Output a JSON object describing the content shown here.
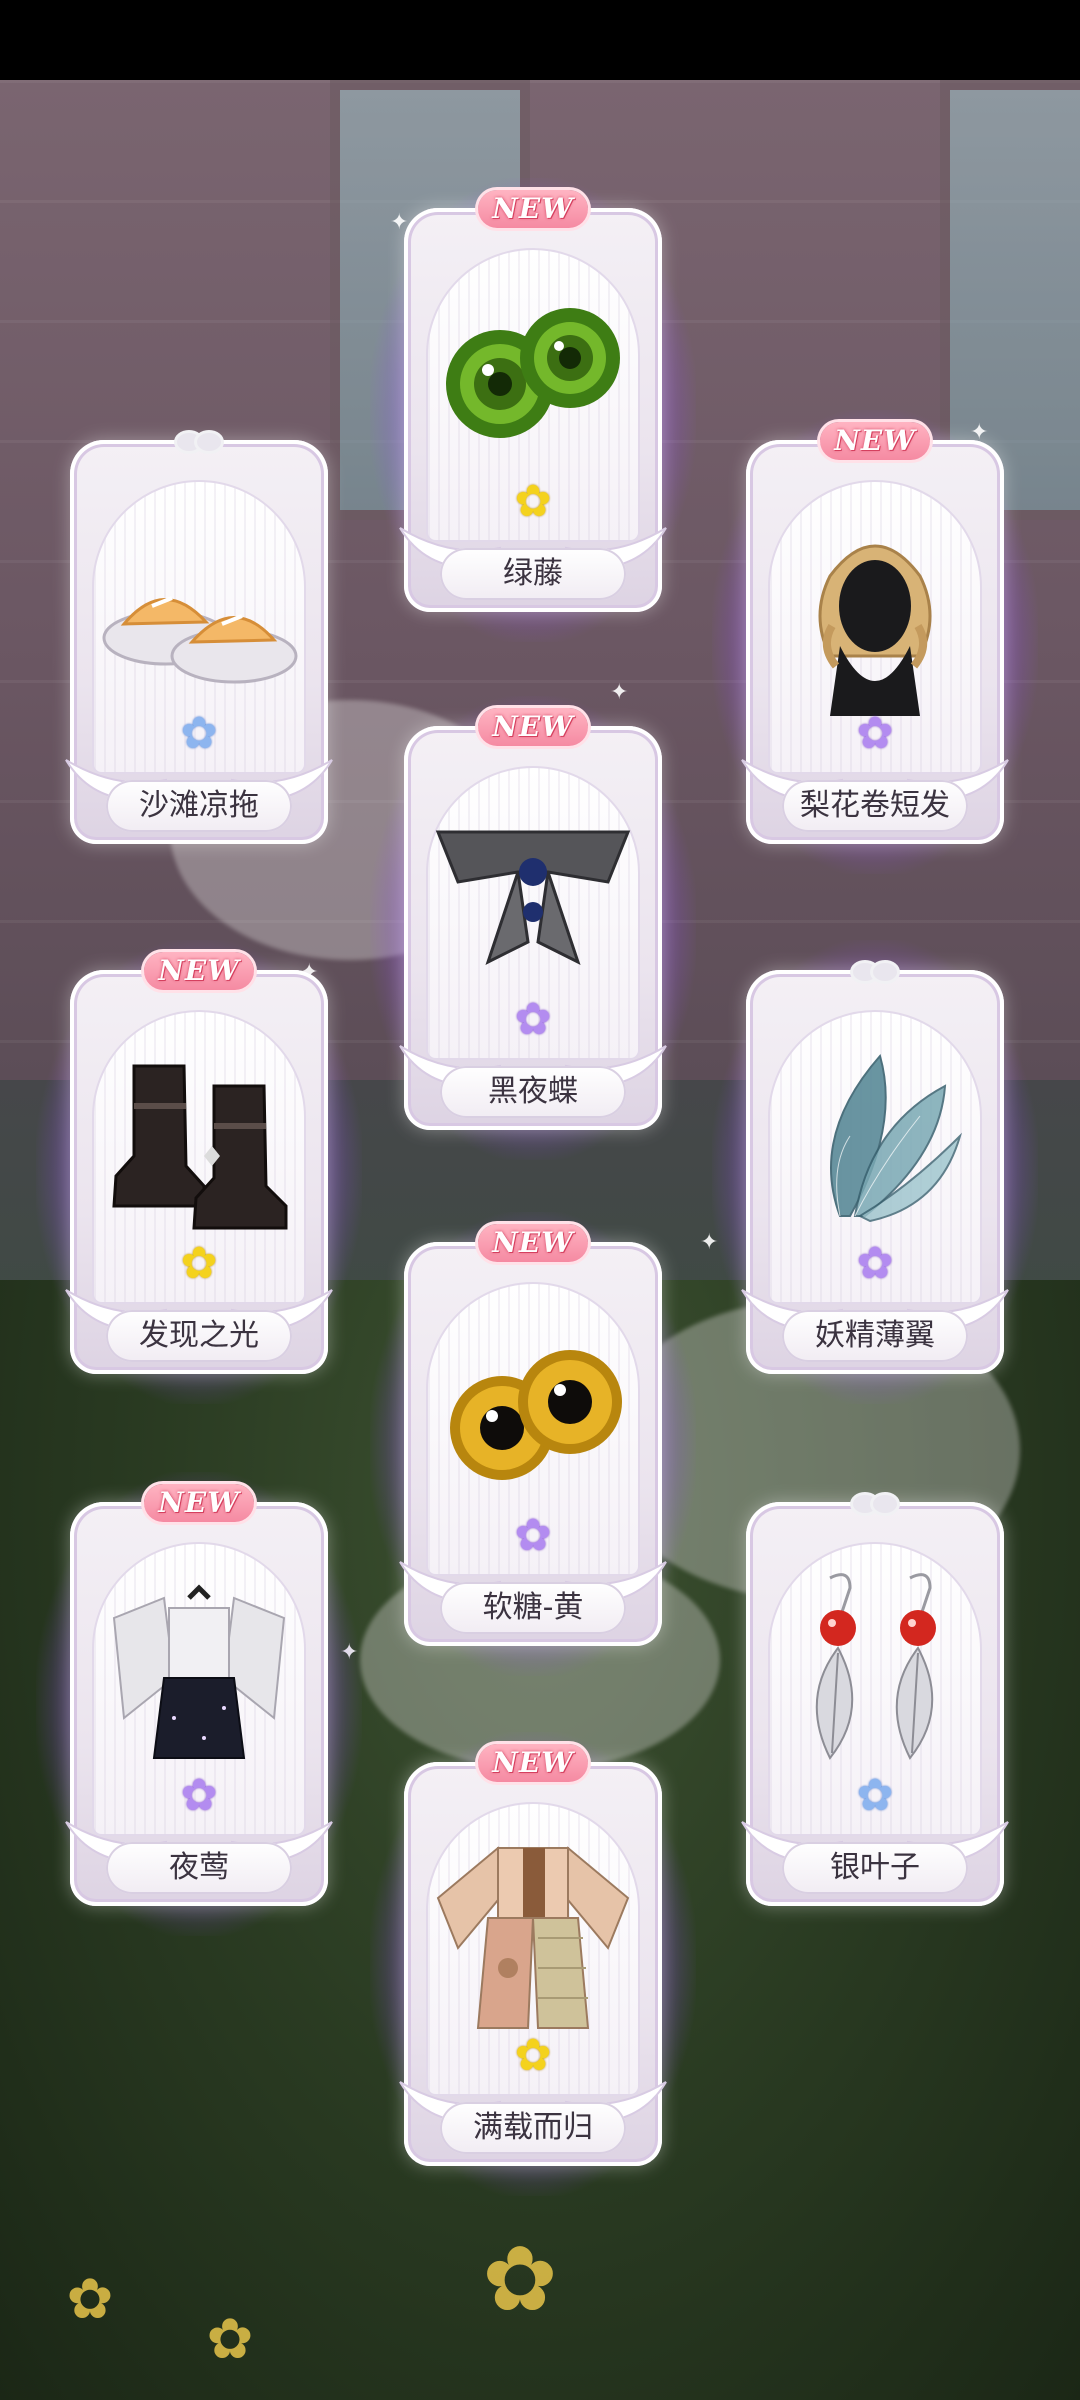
{
  "new_badge_text": "NEW",
  "items": [
    {
      "name": "绿藤",
      "is_new": true,
      "rarity": "gold",
      "icon": "green-eyes-icon"
    },
    {
      "name": "沙滩凉拖",
      "is_new": false,
      "rarity": "blue",
      "icon": "beach-slippers-icon"
    },
    {
      "name": "梨花卷短发",
      "is_new": true,
      "rarity": "purple",
      "icon": "short-curly-hair-icon"
    },
    {
      "name": "黑夜蝶",
      "is_new": true,
      "rarity": "purple",
      "icon": "black-bow-collar-icon"
    },
    {
      "name": "发现之光",
      "is_new": true,
      "rarity": "gold",
      "icon": "black-boots-icon"
    },
    {
      "name": "妖精薄翼",
      "is_new": true,
      "rarity": "purple",
      "icon": "fairy-wings-icon"
    },
    {
      "name": "软糖-黄",
      "is_new": true,
      "rarity": "purple",
      "icon": "yellow-eyes-icon"
    },
    {
      "name": "夜莺",
      "is_new": true,
      "rarity": "purple",
      "icon": "nightingale-outfit-icon"
    },
    {
      "name": "银叶子",
      "is_new": false,
      "rarity": "blue",
      "icon": "silver-leaf-earrings-icon"
    },
    {
      "name": "满载而归",
      "is_new": true,
      "rarity": "gold",
      "icon": "patchwork-outfit-icon"
    }
  ],
  "colors": {
    "glow": "#b46eff",
    "badge": "#f58aa2",
    "rarity_gold": "#f4d21d",
    "rarity_purple": "#b38cf0",
    "rarity_blue": "#8db5ef"
  }
}
